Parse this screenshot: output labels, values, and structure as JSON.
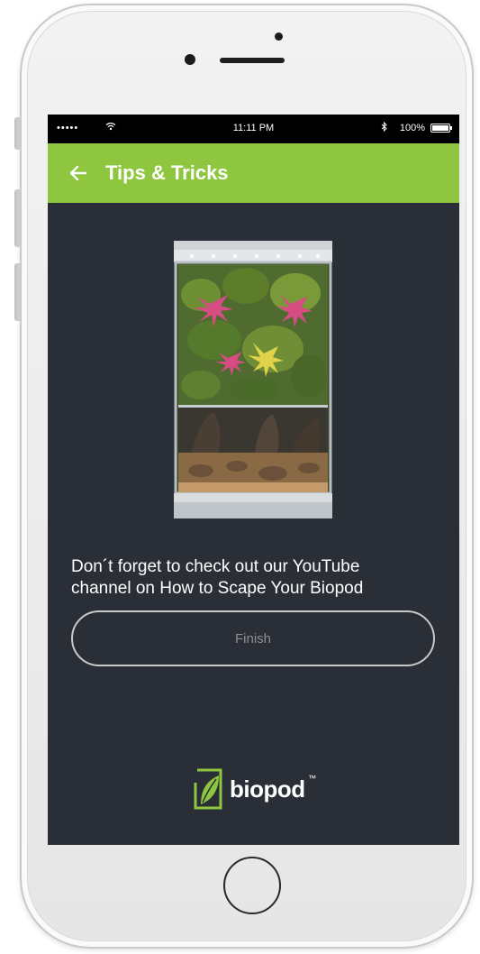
{
  "status_bar": {
    "signal": "•••••",
    "time": "11:11 PM",
    "battery": "100%"
  },
  "app_bar": {
    "title": "Tips & Tricks",
    "back_icon": "arrow-left-icon"
  },
  "content": {
    "message_line1": "Don´t forget to check out our YouTube",
    "message_line2": "channel on How to Scape Your Biopod",
    "finish_label": "Finish"
  },
  "brand": {
    "name": "biopod",
    "trademark": "™"
  },
  "colors": {
    "accent": "#8ec63f",
    "background": "#2a2e36",
    "status_bar": "#000000",
    "button_text": "#8c8f96"
  }
}
